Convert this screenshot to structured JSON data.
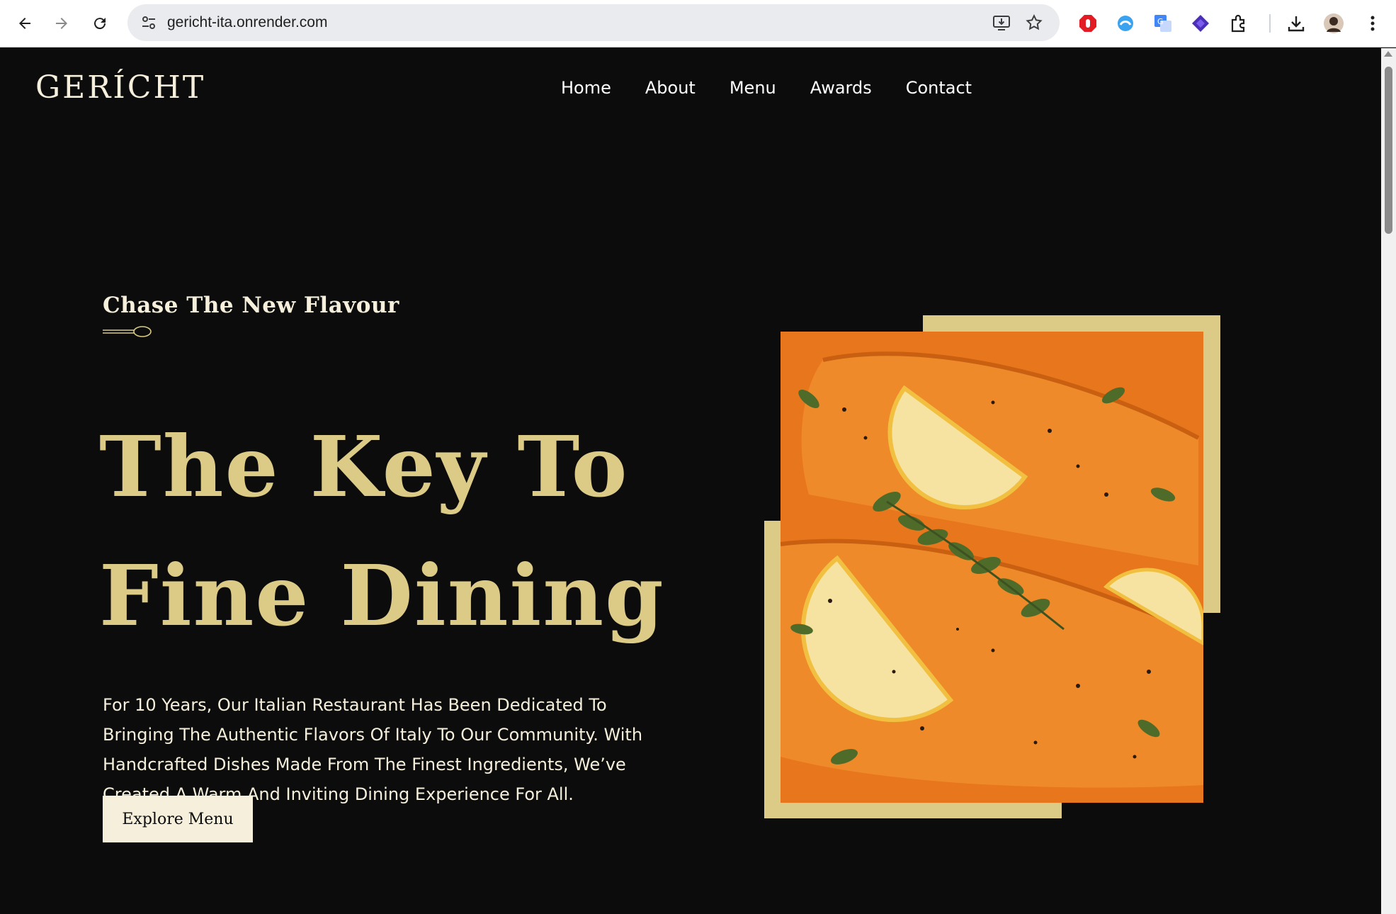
{
  "browser": {
    "url": "gericht-ita.onrender.com",
    "icons": [
      "back-icon",
      "forward-icon",
      "reload-icon",
      "site-settings-icon",
      "install-app-icon",
      "bookmark-star-icon",
      "adblock-extension-icon",
      "blue-extension-icon",
      "translate-extension-icon",
      "purple-extension-icon",
      "extensions-puzzle-icon",
      "download-icon",
      "profile-avatar",
      "more-menu-icon"
    ]
  },
  "site": {
    "logo": "GERÍCHT",
    "nav": [
      "Home",
      "About",
      "Menu",
      "Awards",
      "Contact"
    ],
    "hero": {
      "tagline": "Chase The New Flavour",
      "headline_line1": "The Key To",
      "headline_line2": "Fine Dining",
      "description": "For 10 Years, Our Italian Restaurant Has Been Dedicated To Bringing The Authentic Flavors Of Italy To Our Community. With Handcrafted Dishes Made From The Finest Ingredients, We’ve Created A Warm And Inviting Dining Experience For All.",
      "button_label": "Explore Menu"
    }
  },
  "colors": {
    "background": "#0c0c0c",
    "gold": "#dcca87",
    "cream": "#f5efdb",
    "food_orange": "#e8761c"
  }
}
